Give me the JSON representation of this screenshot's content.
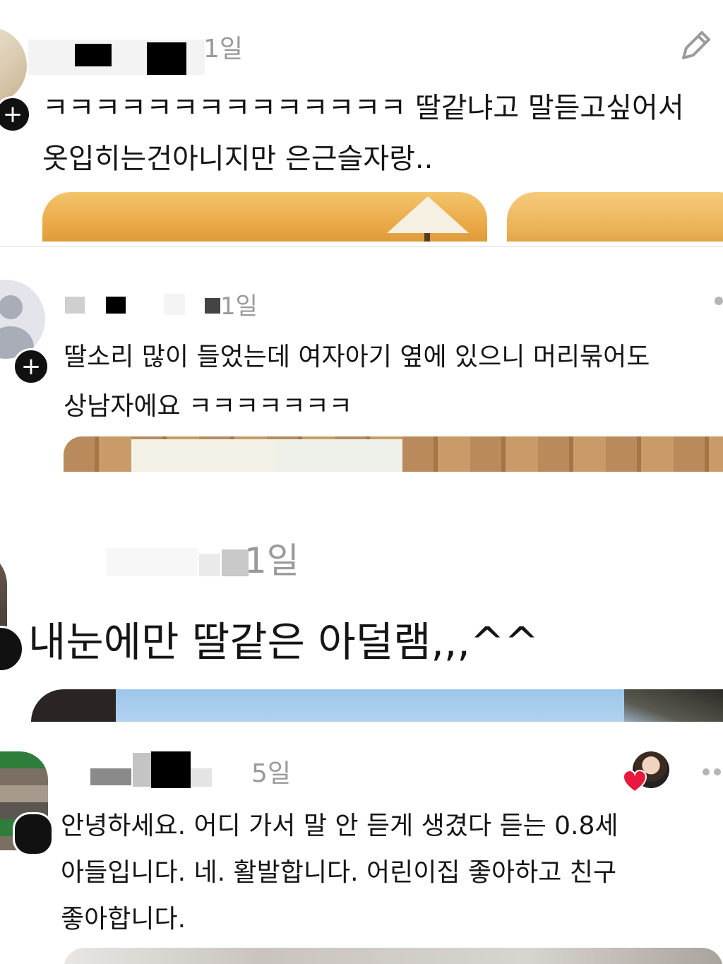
{
  "posts": [
    {
      "time": "1일",
      "lines": [
        "ㅋㅋㅋㅋㅋㅋㅋㅋㅋㅋㅋㅋㅋㅋ 딸같냐고 말듣고싶어서",
        "옷입히는건아니지만 은근슬자랑.."
      ],
      "edit_icon": "pencil-icon"
    },
    {
      "time": "1일",
      "lines": [
        "딸소리 많이 들었는데 여자아기 옆에 있으니 머리묶어도",
        "상남자에요 ㅋㅋㅋㅋㅋㅋㅋ"
      ],
      "more_icon": "more-icon"
    },
    {
      "time": "1일",
      "lines": [
        "내눈에만 딸같은 아덜램,,,^^"
      ]
    },
    {
      "time": "5일",
      "lines": [
        "안녕하세요. 어디 가서 말 안 듣게 생겼다 듣는 0.8세",
        "아들입니다. 네. 활발합니다. 어린이집 좋아하고 친구",
        "좋아합니다."
      ],
      "more_icon": "more-icon"
    }
  ],
  "icons": {
    "follow": "plus-icon",
    "like": "heart-icon"
  },
  "colors": {
    "heart": "#e8193c",
    "muted": "#9a9a9a",
    "text": "#151515"
  }
}
